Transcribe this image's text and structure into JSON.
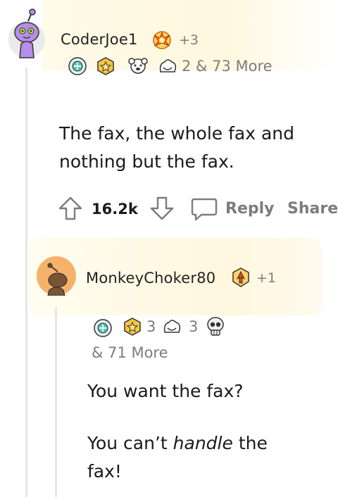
{
  "comment": {
    "username": "CoderJoe1",
    "extra_awards": "+3",
    "awards_more": "2 & 73 More",
    "body": "The fax, the whole fax and nothing but the fax.",
    "score": "16.2k",
    "reply_label": "Reply",
    "share_label": "Share"
  },
  "reply": {
    "username": "MonkeyChoker80",
    "extra_awards": "+1",
    "award_count_a": "3",
    "award_count_b": "3",
    "awards_more": "& 71 More",
    "line1": "You want the fax?",
    "line2_pre": "You can’t ",
    "line2_em": "handle",
    "line2_post": " the",
    "line3": "fax!"
  },
  "colors": {
    "avatar_purple": "#b68ee8",
    "avatar_orange": "#f6b26b",
    "thread_line": "#e6e6e6",
    "meta_gray": "#7c7c7c"
  }
}
